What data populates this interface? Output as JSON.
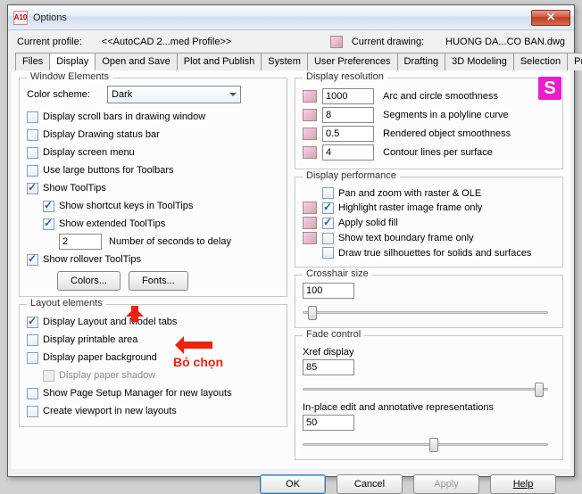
{
  "window": {
    "title": "Options",
    "app_icon": "A10"
  },
  "infobar": {
    "profile_label": "Current profile:",
    "profile_value": "<<AutoCAD 2...med Profile>>",
    "drawing_label": "Current drawing:",
    "drawing_value": "HUONG DA...CO BAN.dwg"
  },
  "tabs": [
    "Files",
    "Display",
    "Open and Save",
    "Plot and Publish",
    "System",
    "User Preferences",
    "Drafting",
    "3D Modeling",
    "Selection",
    "Profiles"
  ],
  "active_tab_index": 1,
  "window_elements": {
    "title": "Window Elements",
    "color_scheme_label": "Color scheme:",
    "color_scheme_value": "Dark",
    "cb_scrollbars": "Display scroll bars in drawing window",
    "cb_statusbar": "Display Drawing status bar",
    "cb_screenmenu": "Display screen menu",
    "cb_largebuttons": "Use large buttons for Toolbars",
    "cb_tooltips": "Show ToolTips",
    "cb_shortcut": "Show shortcut keys in ToolTips",
    "cb_extended": "Show extended ToolTips",
    "delay_value": "2",
    "delay_label": "Number of seconds to delay",
    "cb_rollover": "Show rollover ToolTips",
    "btn_colors": "Colors...",
    "btn_fonts": "Fonts..."
  },
  "layout_elements": {
    "title": "Layout elements",
    "cb_layoutmodel": "Display Layout and Model tabs",
    "cb_printable": "Display printable area",
    "cb_paperbg": "Display paper background",
    "cb_papershadow": "Display paper shadow",
    "cb_pagesetup": "Show Page Setup Manager for new layouts",
    "cb_viewport": "Create viewport in new layouts"
  },
  "display_resolution": {
    "title": "Display resolution",
    "r1_val": "1000",
    "r1_lbl": "Arc and circle smoothness",
    "r2_val": "8",
    "r2_lbl": "Segments in a polyline curve",
    "r3_val": "0.5",
    "r3_lbl": "Rendered object smoothness",
    "r4_val": "4",
    "r4_lbl": "Contour lines per surface"
  },
  "display_performance": {
    "title": "Display performance",
    "p1": "Pan and zoom with raster & OLE",
    "p2": "Highlight raster image frame only",
    "p3": "Apply solid fill",
    "p4": "Show text boundary frame only",
    "p5": "Draw true silhouettes for solids and surfaces"
  },
  "crosshair": {
    "title": "Crosshair size",
    "value": "100",
    "thumb_pct": 2
  },
  "fade": {
    "title": "Fade control",
    "xref_label": "Xref display",
    "xref_value": "85",
    "xref_thumb_pct": 92,
    "inplace_label": "In-place edit and annotative representations",
    "inplace_value": "50",
    "inplace_thumb_pct": 50
  },
  "footer": {
    "ok": "OK",
    "cancel": "Cancel",
    "apply": "Apply",
    "help": "Help"
  },
  "annotation": "Bỏ chọn",
  "badge": "S"
}
